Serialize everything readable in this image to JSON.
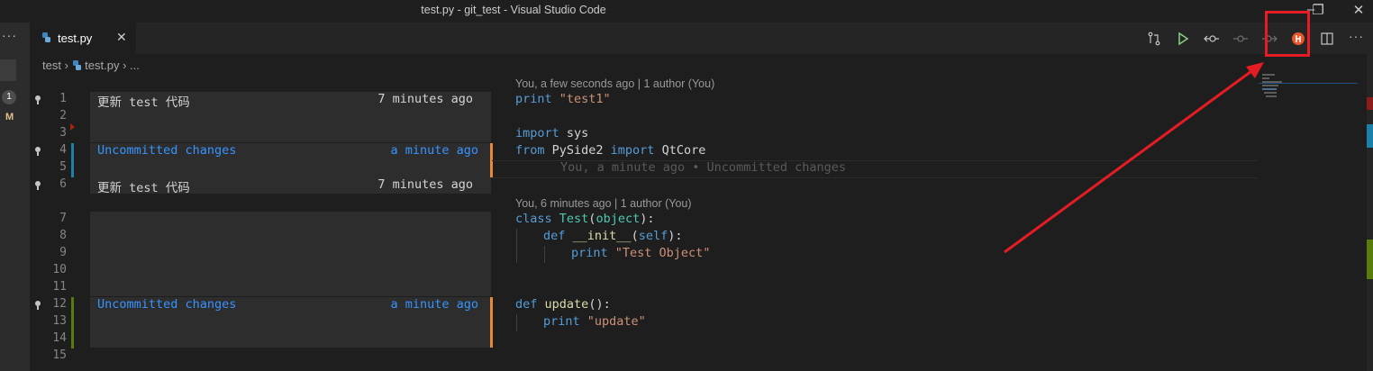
{
  "window": {
    "title": "test.py - git_test - Visual Studio Code",
    "controls": {
      "minimize": "–",
      "restore": "❐",
      "close": "✕"
    }
  },
  "activity": {
    "more": "···",
    "badge_count": "1",
    "scm_letter": "M"
  },
  "tab": {
    "filename": "test.py",
    "close": "✕",
    "icon": "python-file-icon"
  },
  "toolbar": {
    "icons": [
      "compare-changes-icon",
      "run-icon",
      "open-changes-icon",
      "previous-commit-icon",
      "next-commit-icon",
      "gitlens-blame-icon",
      "split-editor-icon",
      "more-actions-icon"
    ],
    "more": "···"
  },
  "breadcrumb": {
    "folder": "test",
    "file": "test.py",
    "ellipsis": "..."
  },
  "gutter": {
    "line_numbers": [
      "1",
      "2",
      "3",
      "4",
      "5",
      "6",
      "7",
      "8",
      "9",
      "10",
      "11",
      "12",
      "13",
      "14",
      "15"
    ]
  },
  "blame": [
    {
      "message": "更新 test 代码",
      "time": "7 minutes ago"
    },
    {
      "message": "Uncommitted changes",
      "time": "a minute ago"
    },
    {
      "message": "更新 test 代码",
      "time": "7 minutes ago"
    },
    {
      "message": "Uncommitted changes",
      "time": "a minute ago"
    }
  ],
  "codelens": [
    "You, a few seconds ago | 1 author (You)",
    "You, 6 minutes ago | 1 author (You)"
  ],
  "inline_blame": "You, a minute ago • Uncommitted changes",
  "code": {
    "l1": {
      "kw": "print",
      "str": "\"test1\""
    },
    "l3": {
      "kw": "import",
      "rest": " sys"
    },
    "l4": {
      "kw1": "from",
      "mid": " PySide2 ",
      "kw2": "import",
      "rest": " QtCore"
    },
    "l6": {
      "kw": "class",
      "cls": "Test",
      "p1": "(",
      "base": "object",
      "p2": "):"
    },
    "l7": {
      "kw": "def",
      "fn": "__init__",
      "p1": "(",
      "self": "self",
      "p2": "):"
    },
    "l8": {
      "kw": "print",
      "str": "\"Test Object\""
    },
    "l12": {
      "kw": "def",
      "fn": "update",
      "p": "():"
    },
    "l13": {
      "kw": "print",
      "str": "\"update\""
    }
  },
  "colors": {
    "uncommitted": "#3794ff",
    "highlight_box": "#e51c23",
    "arrow": "#e51c23",
    "change_bar_modified": "#1b81a8",
    "change_bar_added": "#587c0c",
    "blame_bar": "#e68a3a"
  }
}
